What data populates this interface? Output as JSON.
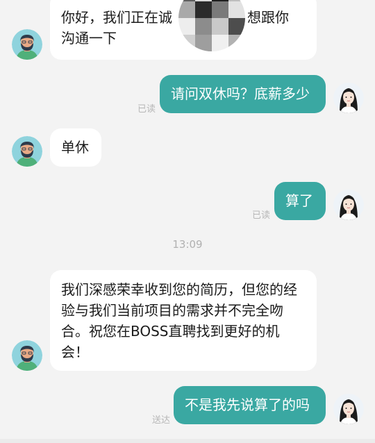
{
  "messages": {
    "m1": {
      "text": "你好，我们正在诚招销售人员，想跟你沟通一下",
      "text_line1": "你好，我们正在诚",
      "text_line1_end": "，想跟你",
      "text_line2": "沟通一下"
    },
    "m2": {
      "text": "请问双休吗？底薪多少",
      "status": "已读"
    },
    "m3": {
      "text": "单休"
    },
    "m4": {
      "text": "算了",
      "status": "已读"
    },
    "time_separator": "13:09",
    "m5": {
      "text": "我们深感荣幸收到您的简历，但您的经验与我们当前项目的需求并不完全吻合。祝您在BOSS直聘找到更好的机会！"
    },
    "m6": {
      "text": "不是我先说算了的吗",
      "status": "送达"
    }
  },
  "colors": {
    "background": "#f3f3f3",
    "incoming_bubble": "#ffffff",
    "outgoing_bubble": "#3aa8a2",
    "status_text": "#b7b7b7"
  },
  "icons": {
    "recruiter_avatar": "bearded-man-avatar-icon",
    "user_avatar": "woman-portrait-avatar-icon",
    "redaction": "pixelated-mosaic-blur"
  }
}
